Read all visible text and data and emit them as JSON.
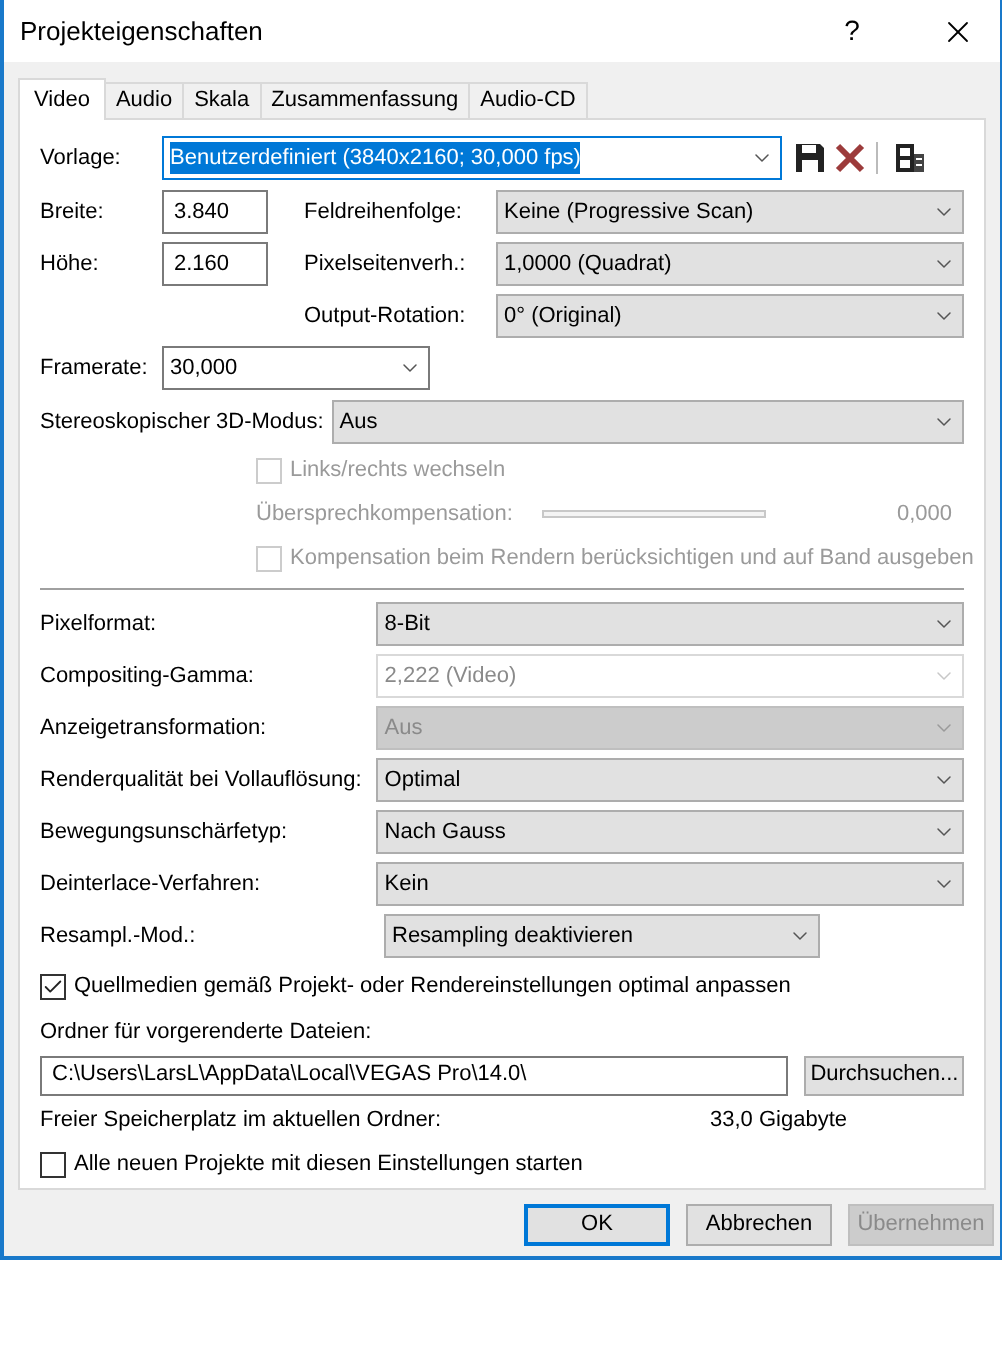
{
  "window": {
    "title": "Projekteigenschaften",
    "help": "?"
  },
  "tabs": [
    {
      "label": "Video",
      "selected": true
    },
    {
      "label": "Audio",
      "selected": false
    },
    {
      "label": "Skala",
      "selected": false
    },
    {
      "label": "Zusammenfassung",
      "selected": false
    },
    {
      "label": "Audio-CD",
      "selected": false
    }
  ],
  "template": {
    "label": "Vorlage:",
    "value": "Benutzerdefiniert (3840x2160; 30,000 fps)",
    "text_selected": true
  },
  "size_fields": [
    {
      "label": "Breite:",
      "value": "3.840"
    },
    {
      "label": "Höhe:",
      "value": "2.160"
    }
  ],
  "field_dropdowns": [
    {
      "label": "Feldreihenfolge:",
      "value": "Keine (Progressive Scan)"
    },
    {
      "label": "Pixelseitenverh.:",
      "value": "1,0000 (Quadrat)"
    },
    {
      "label": "Output-Rotation:",
      "value": "0° (Original)"
    }
  ],
  "framerate": {
    "label": "Framerate:",
    "value": "30,000"
  },
  "stereo": {
    "label": "Stereoskopischer 3D-Modus:",
    "value": "Aus"
  },
  "stereo_options": [
    {
      "kind": "checkbox",
      "label": "Links/rechts wechseln",
      "checked": false,
      "disabled": true
    },
    {
      "kind": "slider",
      "label": "Übersprechkompensation:",
      "level": 0,
      "reading": "0,000",
      "disabled": true
    },
    {
      "kind": "checkbox",
      "label": "Kompensation beim Rendern berücksichtigen und auf Band ausgeben",
      "checked": false,
      "disabled": true
    }
  ],
  "settings": [
    {
      "label": "Pixelformat:",
      "value": "8-Bit",
      "kind": "dropdown",
      "disabled": false
    },
    {
      "label": "Compositing-Gamma:",
      "value": "2,222 (Video)",
      "kind": "combo",
      "disabled": true
    },
    {
      "label": "Anzeigetransformation:",
      "value": "Aus",
      "kind": "dropdown",
      "disabled": true
    },
    {
      "label": "Renderqualität bei Vollauflösung:",
      "value": "Optimal",
      "kind": "dropdown",
      "disabled": false
    },
    {
      "label": "Bewegungsunschärfetyp:",
      "value": "Nach Gauss",
      "kind": "dropdown",
      "disabled": false
    },
    {
      "label": "Deinterlace-Verfahren:",
      "value": "Kein",
      "kind": "dropdown",
      "disabled": false
    },
    {
      "label": "Resampl.-Mod.:",
      "value": "Resampling deaktivieren",
      "kind": "short-dropdown",
      "disabled": false
    }
  ],
  "match_media": {
    "label": "Quellmedien gemäß Projekt- oder Rendereinstellungen optimal anpassen",
    "checked": true
  },
  "folder": {
    "label": "Ordner für vorgerenderte Dateien:",
    "value": "C:\\Users\\LarsL\\AppData\\Local\\VEGAS Pro\\14.0\\",
    "browse": "Durchsuchen..."
  },
  "free_space": {
    "label": "Freier Speicherplatz im aktuellen Ordner:",
    "value": "33,0 Gigabyte"
  },
  "start_new": {
    "label": "Alle neuen Projekte mit diesen Einstellungen starten",
    "checked": false
  },
  "buttons": [
    {
      "label": "OK",
      "default": true,
      "disabled": false
    },
    {
      "label": "Abbrechen",
      "default": false,
      "disabled": false
    },
    {
      "label": "Übernehmen",
      "default": false,
      "disabled": true
    }
  ]
}
